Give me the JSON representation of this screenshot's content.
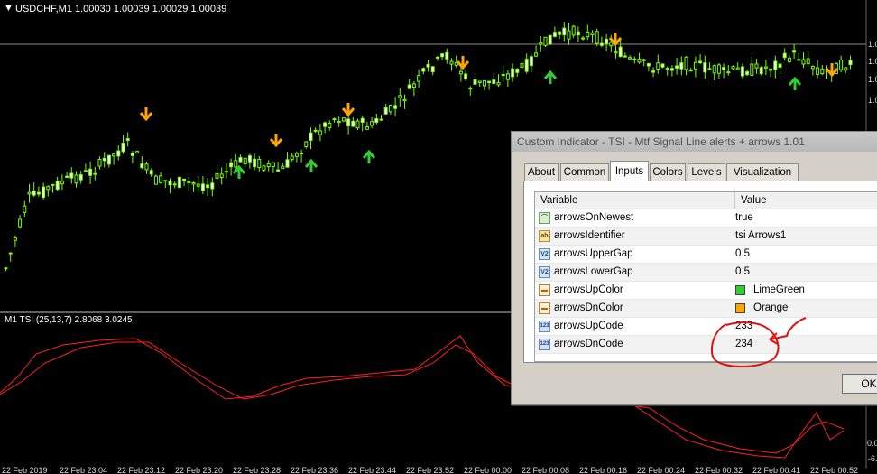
{
  "chart": {
    "symbol_label": "USDCHF,M1  1.00030 1.00039 1.00029 1.00039",
    "indicator_label": "M1 TSI (25,13,7) 2.8068 3.0245",
    "price_axis": [
      "1.0",
      "1.0",
      "1.0",
      "1.0"
    ],
    "tsi_axis": [
      "0.0",
      "-6."
    ],
    "time_axis": [
      "22 Feb 2019",
      "22 Feb 23:04",
      "22 Feb 23:12",
      "22 Feb 23:20",
      "22 Feb 23:28",
      "22 Feb 23:36",
      "22 Feb 23:44",
      "22 Feb 23:52",
      "22 Feb 00:00",
      "22 Feb 00:08",
      "22 Feb 00:16",
      "22 Feb 00:24",
      "22 Feb 00:32",
      "22 Feb 00:41",
      "22 Feb 00:52"
    ],
    "colors": {
      "background": "#000000",
      "candle": "#7cfc00",
      "up_arrow": "#32cd32",
      "down_arrow": "#ffa500",
      "tsi_line": "#ff2020"
    }
  },
  "dialog": {
    "title": "Custom Indicator - TSI - Mtf Signal Line alerts + arrows 1.01",
    "tabs": [
      "About",
      "Common",
      "Inputs",
      "Colors",
      "Levels",
      "Visualization"
    ],
    "active_tab": "Inputs",
    "columns": {
      "variable": "Variable",
      "value": "Value"
    },
    "rows": [
      {
        "icon": "chart-type-icon",
        "variable": "arrowsOnNewest",
        "value": "true"
      },
      {
        "icon": "string-type-icon",
        "icon_text": "ab",
        "variable": "arrowsIdentifier",
        "value": "tsi Arrows1"
      },
      {
        "icon": "double-type-icon",
        "icon_text": "V2",
        "variable": "arrowsUpperGap",
        "value": "0.5"
      },
      {
        "icon": "double-type-icon",
        "icon_text": "V2",
        "variable": "arrowsLowerGap",
        "value": "0.5"
      },
      {
        "icon": "color-type-icon",
        "variable": "arrowsUpColor",
        "value": "LimeGreen",
        "swatch": "#32cd32"
      },
      {
        "icon": "color-type-icon",
        "variable": "arrowsDnColor",
        "value": "Orange",
        "swatch": "#ffa500"
      },
      {
        "icon": "integer-type-icon",
        "icon_text": "123",
        "variable": "arrowsUpCode",
        "value": "233"
      },
      {
        "icon": "integer-type-icon",
        "icon_text": "123",
        "variable": "arrowsDnCode",
        "value": "234"
      }
    ],
    "ok_label": "OK"
  }
}
